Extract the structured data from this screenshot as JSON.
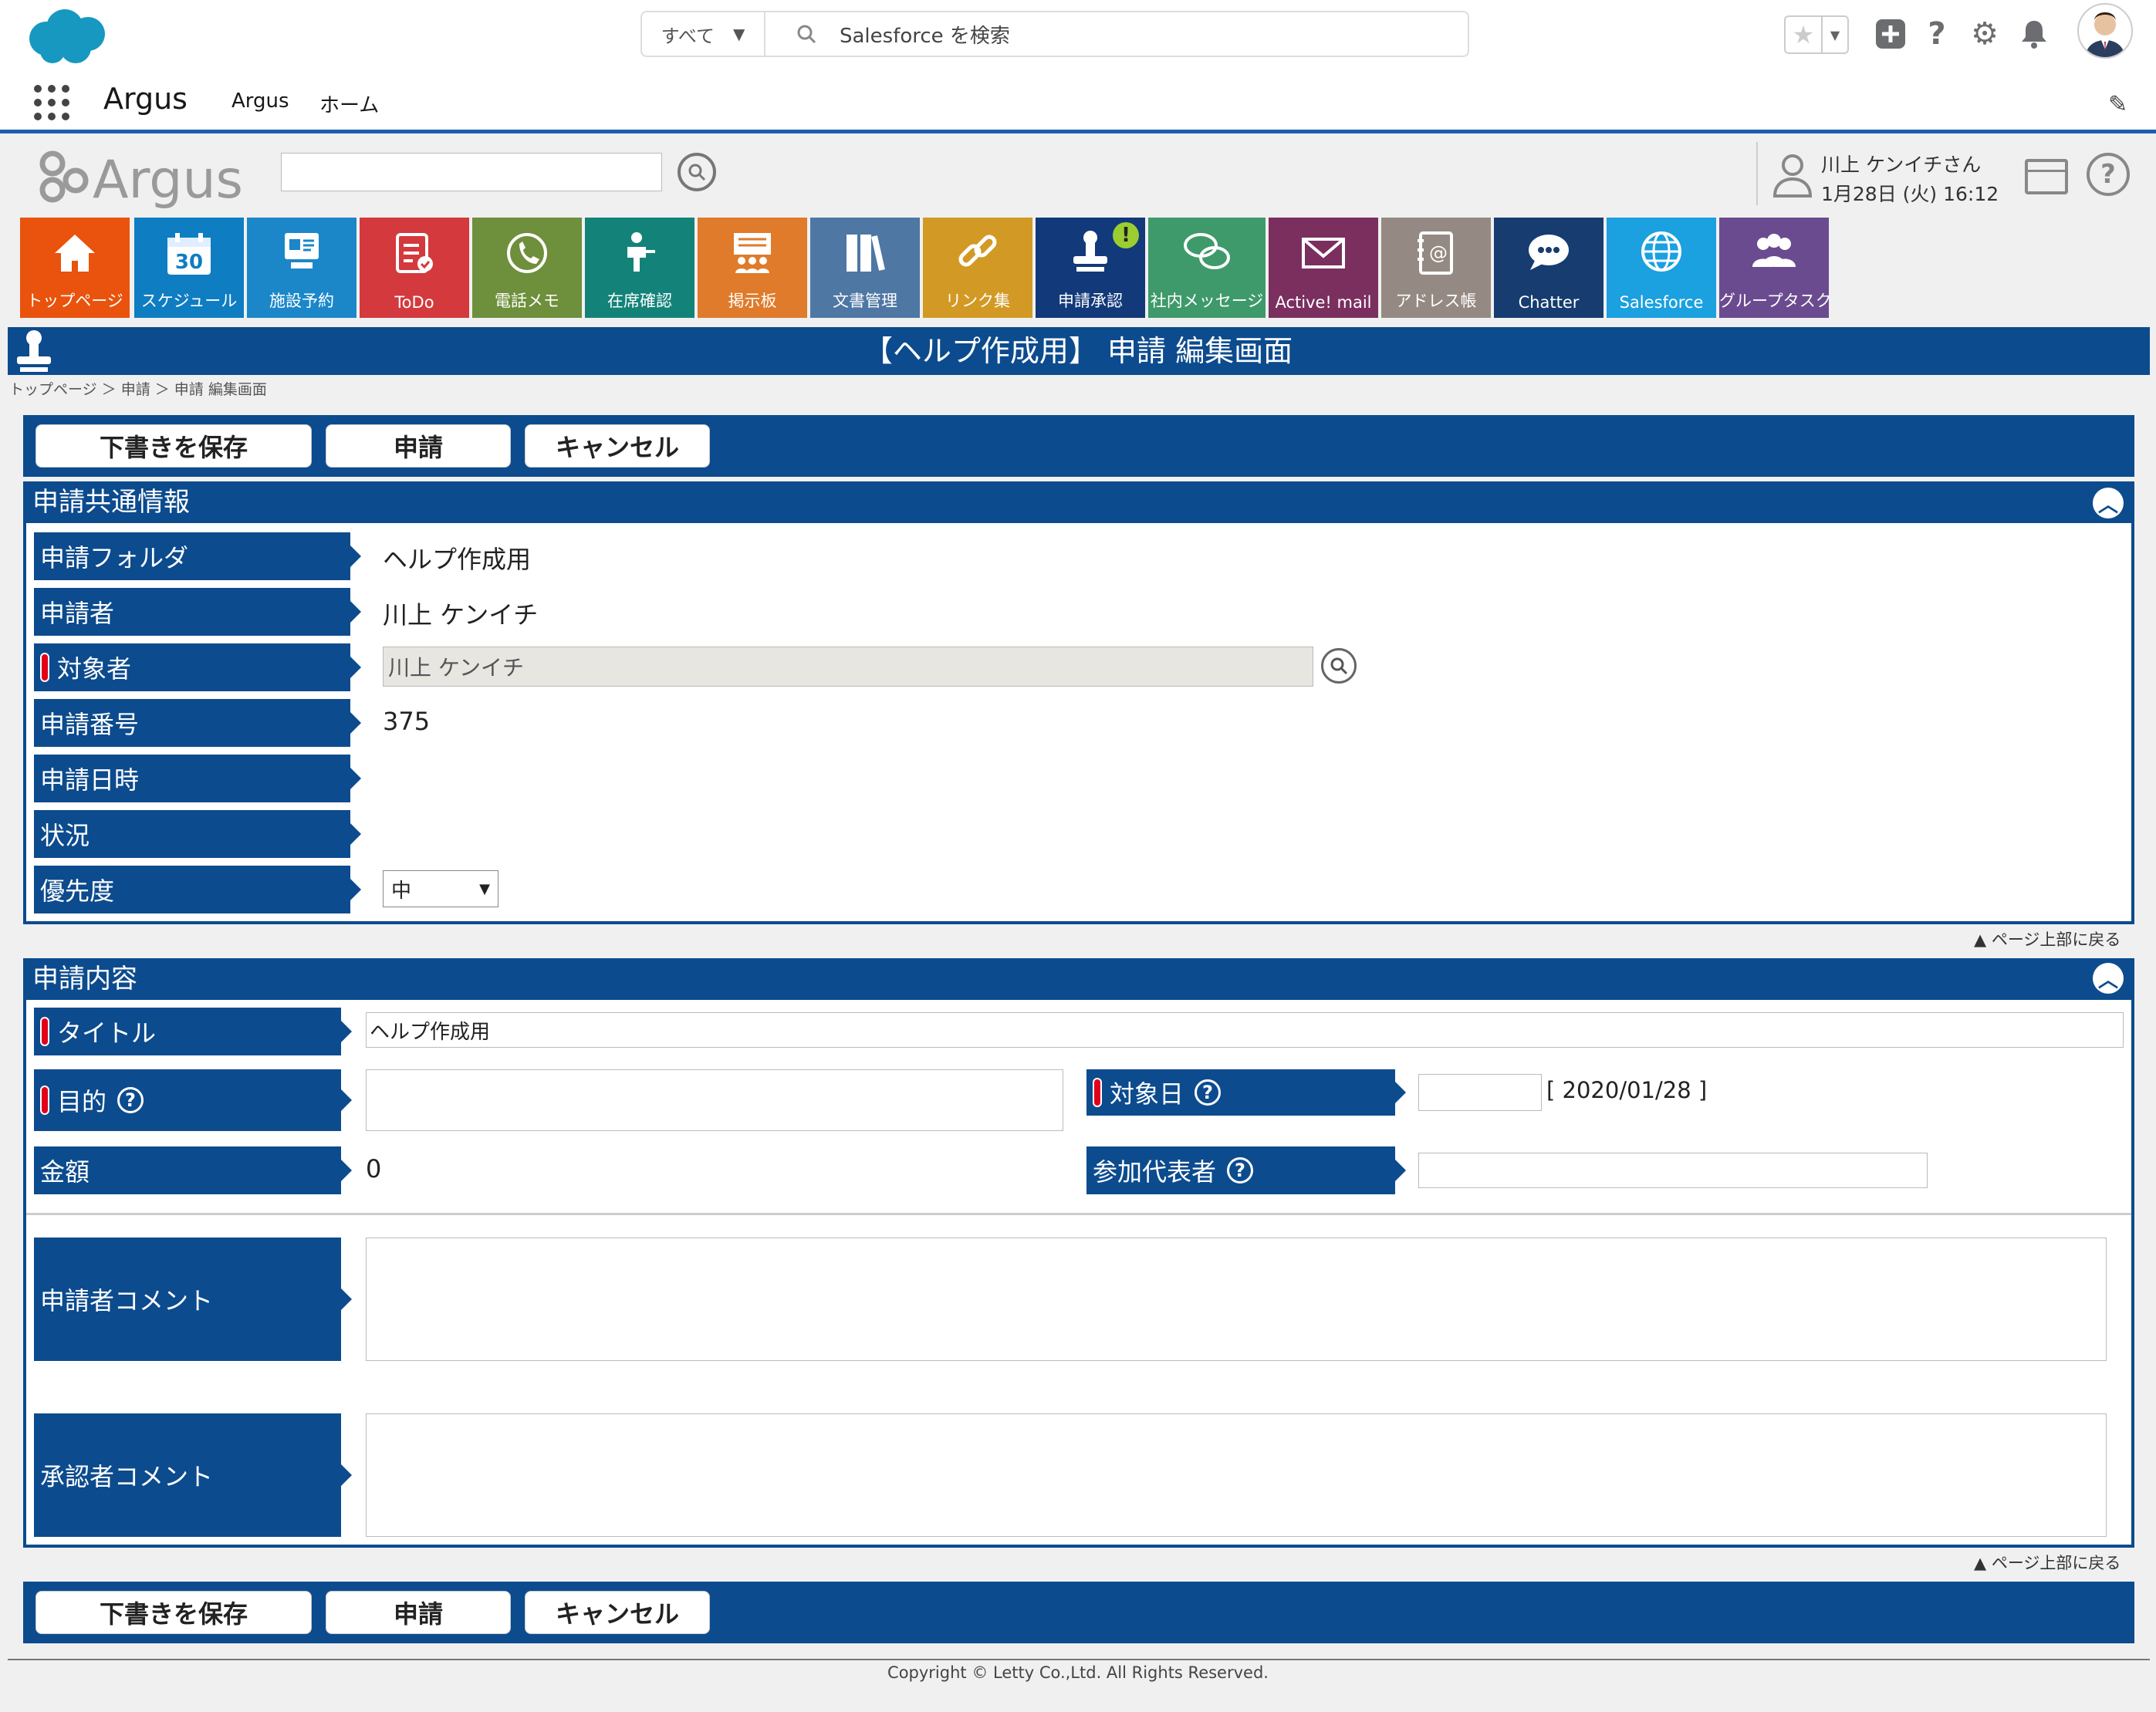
{
  "sf_header": {
    "search_scope": "すべて",
    "search_placeholder": "Salesforce を検索",
    "app_name": "Argus",
    "nav": [
      "Argus",
      "ホーム"
    ]
  },
  "argus_header": {
    "user_name": "川上 ケンイチさん",
    "date_time": "1月28日 (火) 16:12"
  },
  "tiles": [
    {
      "label": "トップページ",
      "color": "#e9530d",
      "icon": "home-icon"
    },
    {
      "label": "スケジュール",
      "color": "#0f7dc2",
      "icon": "calendar-icon",
      "extra": "30"
    },
    {
      "label": "施設予約",
      "color": "#1b87c9",
      "icon": "facility-icon"
    },
    {
      "label": "ToDo",
      "color": "#d4393d",
      "icon": "todo-icon"
    },
    {
      "label": "電話メモ",
      "color": "#6e8f3b",
      "icon": "phone-icon"
    },
    {
      "label": "在席確認",
      "color": "#13837a",
      "icon": "presence-icon"
    },
    {
      "label": "掲示板",
      "color": "#df7b2b",
      "icon": "bulletin-icon"
    },
    {
      "label": "文書管理",
      "color": "#4e77a3",
      "icon": "document-icon"
    },
    {
      "label": "リンク集",
      "color": "#d29a24",
      "icon": "link-icon"
    },
    {
      "label": "申請承認",
      "color": "#12397a",
      "icon": "stamp-icon",
      "badge": "!"
    },
    {
      "label": "社内メッセージ",
      "color": "#3f9a6b",
      "icon": "message-icon"
    },
    {
      "label": "Active! mail",
      "color": "#7a2f5f",
      "icon": "mail-icon"
    },
    {
      "label": "アドレス帳",
      "color": "#958a83",
      "icon": "address-book-icon"
    },
    {
      "label": "Chatter",
      "color": "#163c70",
      "icon": "chatter-icon"
    },
    {
      "label": "Salesforce",
      "color": "#1ba0e0",
      "icon": "globe-icon"
    },
    {
      "label": "グループタスク",
      "color": "#6b4b8f",
      "icon": "group-icon"
    }
  ],
  "page": {
    "title": "【ヘルプ作成用】 申請 編集画面",
    "breadcrumb": "トップページ ＞ 申請 ＞ 申請 編集画面"
  },
  "buttons": {
    "save_draft": "下書きを保存",
    "apply": "申請",
    "cancel": "キャンセル"
  },
  "common": {
    "title": "申請共通情報",
    "folder_label": "申請フォルダ",
    "folder_value": "ヘルプ作成用",
    "applicant_label": "申請者",
    "applicant_value": "川上 ケンイチ",
    "target_person_label": "対象者",
    "target_person_value": "川上 ケンイチ",
    "number_label": "申請番号",
    "number_value": "375",
    "datetime_label": "申請日時",
    "status_label": "状況",
    "priority_label": "優先度",
    "priority_value": "中"
  },
  "back_to_top": "▲ ページ上部に戻る",
  "content": {
    "title": "申請内容",
    "title_label": "タイトル",
    "title_value": "ヘルプ作成用",
    "purpose_label": "目的",
    "target_date_label": "対象日",
    "target_date_hint": "[ 2020/01/28 ]",
    "amount_label": "金額",
    "amount_value": "0",
    "participant_label": "参加代表者",
    "applicant_comment_label": "申請者コメント",
    "approver_comment_label": "承認者コメント"
  },
  "footer": {
    "copyright": "Copyright © Letty Co.,Ltd. All Rights Reserved."
  }
}
